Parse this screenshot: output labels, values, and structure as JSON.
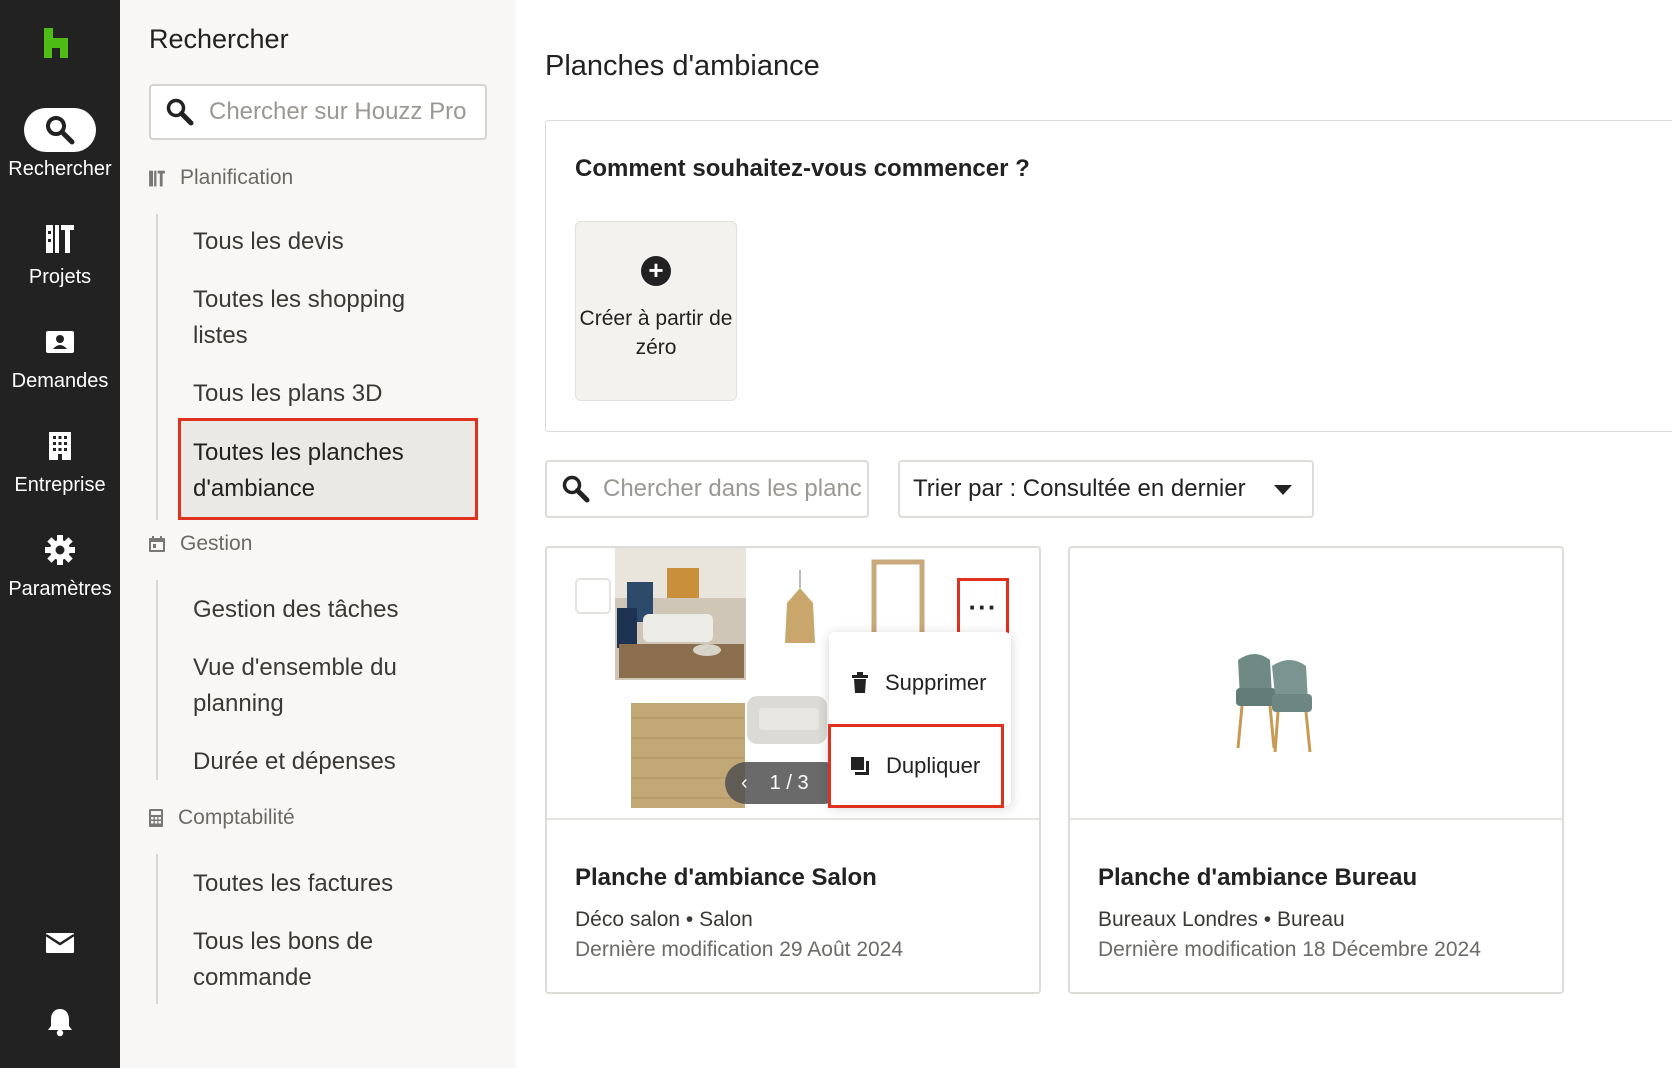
{
  "rail": {
    "items": [
      {
        "label": "Rechercher",
        "icon": "search-icon"
      },
      {
        "label": "Projets",
        "icon": "projects-icon"
      },
      {
        "label": "Demandes",
        "icon": "requests-icon"
      },
      {
        "label": "Entreprise",
        "icon": "building-icon"
      },
      {
        "label": "Paramètres",
        "icon": "gear-icon"
      }
    ],
    "bottom": [
      "mail-icon",
      "bell-icon"
    ],
    "accent": "#4dbc15"
  },
  "sidebar": {
    "title": "Rechercher",
    "search_placeholder": "Chercher sur Houzz Pro",
    "groups": [
      {
        "header": "Planification",
        "items": [
          "Tous les devis",
          "Toutes les shopping listes",
          "Tous les plans 3D",
          "Toutes les planches d'ambiance"
        ],
        "selected": "Toutes les planches d'ambiance"
      },
      {
        "header": "Gestion",
        "items": [
          "Gestion des tâches",
          "Vue d'ensemble du planning",
          "Durée et dépenses"
        ]
      },
      {
        "header": "Comptabilité",
        "items": [
          "Toutes les factures",
          "Tous les bons de commande"
        ]
      }
    ]
  },
  "main": {
    "title": "Planches d'ambiance",
    "start": {
      "question": "Comment souhaitez-vous commencer ?",
      "create_label": "Créer à partir de zéro"
    },
    "search_placeholder": "Chercher dans les planches",
    "sort_label": "Trier par : Consultée en dernier",
    "cards": [
      {
        "name": "Planche d'ambiance Salon",
        "project": "Déco salon",
        "room": "Salon",
        "modified": "Dernière modification 29 Août 2024",
        "pager": "1 / 3"
      },
      {
        "name": "Planche d'ambiance Bureau",
        "project": "Bureaux Londres",
        "room": "Bureau",
        "modified": "Dernière modification 18 Décembre 2024"
      }
    ],
    "menu": {
      "delete": "Supprimer",
      "duplicate": "Dupliquer"
    },
    "more_label": "···",
    "meta_separator": "•",
    "highlight_color": "#e0301e"
  }
}
